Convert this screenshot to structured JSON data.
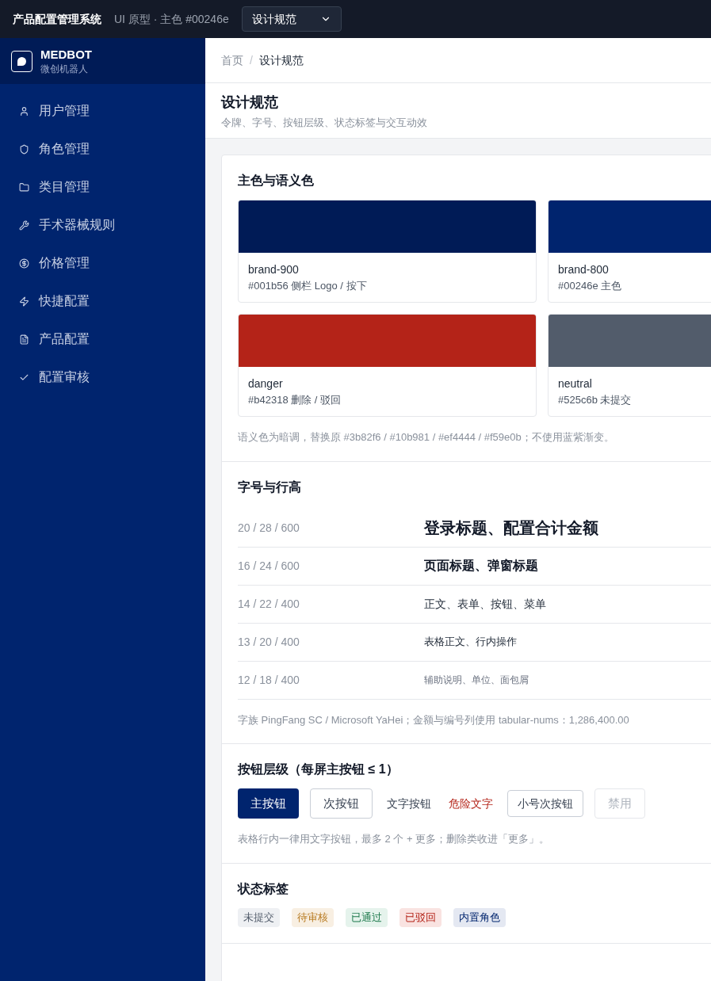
{
  "topbar": {
    "title": "产品配置管理系统",
    "subtitle": "UI 原型 · 主色 #00246e",
    "page_select": {
      "value": "设计规范"
    }
  },
  "sidebar": {
    "brand": {
      "name": "MEDBOT",
      "tagline": "微创机器人"
    },
    "items": [
      {
        "label": "用户管理",
        "kind": "user"
      },
      {
        "label": "角色管理",
        "kind": "shield"
      },
      {
        "label": "类目管理",
        "kind": "folder"
      },
      {
        "label": "手术器械规则",
        "kind": "tool"
      },
      {
        "label": "价格管理",
        "kind": "price"
      },
      {
        "label": "快捷配置",
        "kind": "zap"
      },
      {
        "label": "产品配置",
        "kind": "doc"
      },
      {
        "label": "配置审核",
        "kind": "check"
      }
    ]
  },
  "breadcrumb": {
    "separator": "/",
    "items": [
      "首页",
      "设计规范"
    ]
  },
  "page_header": {
    "title": "设计规范",
    "subtitle": "令牌、字号、按钮层级、状态标签与交互动效"
  },
  "colors": {
    "heading": "主色与语义色",
    "swatches": [
      {
        "name": "brand-900",
        "desc": "#001b56 侧栏 Logo / 按下",
        "color": "#001b56"
      },
      {
        "name": "brand-800",
        "desc": "#00246e 主色",
        "color": "#00246e"
      },
      {
        "name": "danger",
        "desc": "#b42318 删除 / 驳回",
        "color": "#b42318"
      },
      {
        "name": "neutral",
        "desc": "#525c6b 未提交",
        "color": "#525c6b"
      }
    ],
    "note": "语义色为暗调，替换原 #3b82f6 / #10b981 / #ef4444 / #f59e0b；不使用蓝紫渐变。"
  },
  "typography": {
    "heading": "字号与行高",
    "rows": [
      {
        "spec": "20 / 28 / 600",
        "sample": "登录标题、配置合计金额",
        "kind": "display"
      },
      {
        "spec": "16 / 24 / 600",
        "sample": "页面标题、弹窗标题",
        "kind": "heading"
      },
      {
        "spec": "14 / 22 / 400",
        "sample": "正文、表单、按钮、菜单",
        "kind": "body"
      },
      {
        "spec": "13 / 20 / 400",
        "sample": "表格正文、行内操作",
        "kind": "table"
      },
      {
        "spec": "12 / 18 / 400",
        "sample": "辅助说明、单位、面包屑",
        "kind": "caption"
      }
    ],
    "note": "字族 PingFang SC / Microsoft YaHei；金额与编号列使用 tabular-nums：1,286,400.00"
  },
  "buttons": {
    "heading": "按钮层级（每屏主按钮 ≤ 1）",
    "items": [
      {
        "label": "主按钮",
        "kind": "primary",
        "disabled": false
      },
      {
        "label": "次按钮",
        "kind": "secondary",
        "disabled": false
      },
      {
        "label": "文字按钮",
        "kind": "text",
        "disabled": false
      },
      {
        "label": "危险文字",
        "kind": "danger",
        "disabled": false
      },
      {
        "label": "小号次按钮",
        "kind": "small",
        "disabled": false
      },
      {
        "label": "禁用",
        "kind": "secondary",
        "disabled": true
      }
    ],
    "note": "表格行内一律用文字按钮，最多 2 个 + 更多；删除类收进「更多」。"
  },
  "status_tags": {
    "heading": "状态标签",
    "items": [
      {
        "label": "未提交",
        "kind": "neutral"
      },
      {
        "label": "待审核",
        "kind": "warning"
      },
      {
        "label": "已通过",
        "kind": "success"
      },
      {
        "label": "已驳回",
        "kind": "danger"
      },
      {
        "label": "内置角色",
        "kind": "brand"
      }
    ]
  }
}
